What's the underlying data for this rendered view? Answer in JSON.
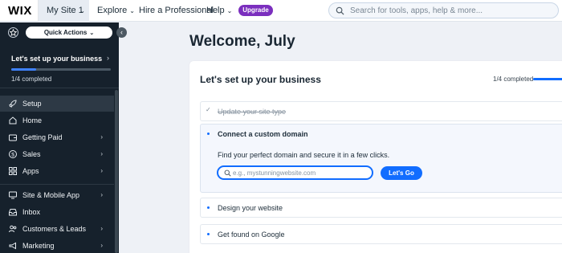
{
  "topbar": {
    "logo": "WIX",
    "site_selector": "My Site 1",
    "nav": [
      "Explore",
      "Hire a Professional",
      "Help"
    ],
    "upgrade_label": "Upgrade",
    "search_placeholder": "Search for tools, apps, help & more..."
  },
  "sidebar": {
    "quick_actions": "Quick Actions",
    "setup_card": {
      "title": "Let's set up your business",
      "progress_text": "1/4 completed",
      "progress_fraction": 0.25
    },
    "items": [
      {
        "label": "Setup",
        "icon": "rocket-icon",
        "active": true,
        "chevron": false
      },
      {
        "label": "Home",
        "icon": "home-icon",
        "active": false,
        "chevron": false
      },
      {
        "label": "Getting Paid",
        "icon": "wallet-icon",
        "active": false,
        "chevron": true
      },
      {
        "label": "Sales",
        "icon": "dollar-icon",
        "active": false,
        "chevron": true
      },
      {
        "label": "Apps",
        "icon": "apps-icon",
        "active": false,
        "chevron": true
      },
      {
        "label": "Site & Mobile App",
        "icon": "monitor-icon",
        "active": false,
        "chevron": true
      },
      {
        "label": "Inbox",
        "icon": "inbox-icon",
        "active": false,
        "chevron": false
      },
      {
        "label": "Customers & Leads",
        "icon": "people-icon",
        "active": false,
        "chevron": true
      },
      {
        "label": "Marketing",
        "icon": "megaphone-icon",
        "active": false,
        "chevron": true
      }
    ]
  },
  "main": {
    "welcome": "Welcome, July",
    "card": {
      "title": "Let's set up your business",
      "progress_text": "1/4 completed",
      "steps": [
        {
          "label": "Update your site type",
          "state": "done"
        },
        {
          "label": "Connect a custom domain",
          "state": "expanded",
          "description": "Find your perfect domain and secure it in a few clicks.",
          "input_placeholder": "e.g., mystunningwebsite.com",
          "button_label": "Let's Go"
        },
        {
          "label": "Design your website",
          "state": "todo"
        },
        {
          "label": "Get found on Google",
          "state": "todo"
        }
      ]
    }
  },
  "colors": {
    "accent": "#116dff",
    "upgrade": "#7b2fbe",
    "sidebar_bg": "#16212c",
    "sidebar_active": "#2d3945",
    "page_bg": "#eef1f6"
  }
}
